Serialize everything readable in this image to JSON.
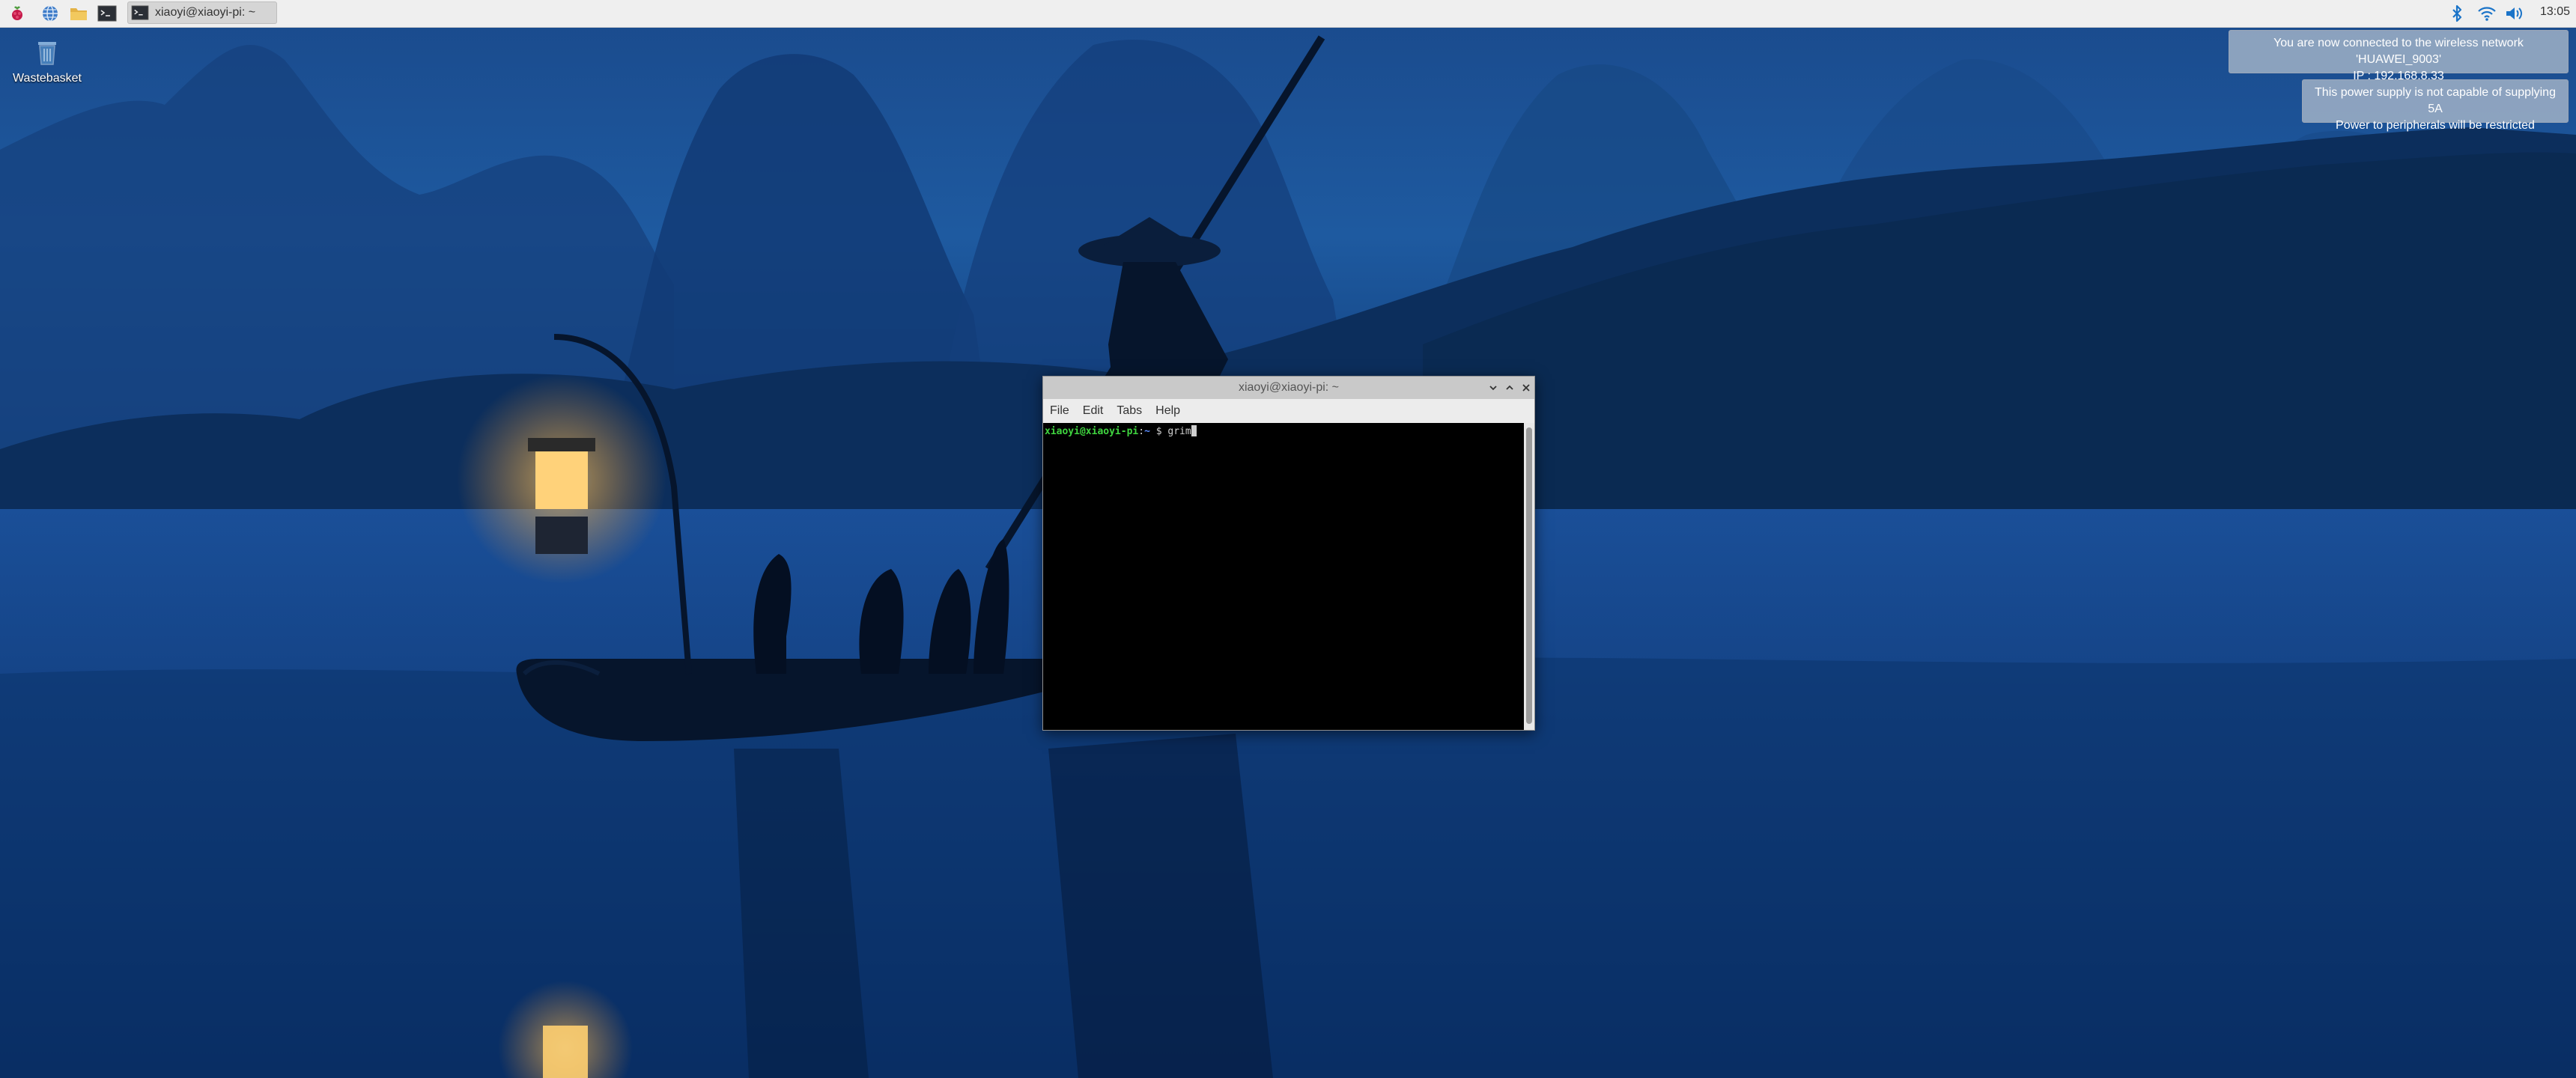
{
  "taskbar": {
    "launchers": [
      "raspberry-menu-icon",
      "web-browser-icon",
      "file-manager-icon",
      "terminal-icon"
    ],
    "window_button_label": "xiaoyi@xiaoyi-pi: ~",
    "tray": [
      "bluetooth-icon",
      "wifi-icon",
      "volume-icon"
    ],
    "clock": "13:05"
  },
  "desktop": {
    "wastebasket_label": "Wastebasket"
  },
  "notifications": {
    "wifi": {
      "line1": "You are now connected to the wireless network 'HUAWEI_9003'",
      "line2": "IP : 192.168.8.33"
    },
    "power": {
      "line1": "This power supply is not capable of supplying 5A",
      "line2": "Power to peripherals will be restricted"
    }
  },
  "terminal": {
    "title": "xiaoyi@xiaoyi-pi: ~",
    "menu": [
      "File",
      "Edit",
      "Tabs",
      "Help"
    ],
    "prompt_user": "xiaoyi@xiaoyi-pi",
    "prompt_sep": ":",
    "prompt_path": "~",
    "prompt_symbol": " $ ",
    "command": "grim"
  },
  "colors": {
    "taskbar_bg": "#efefef",
    "prompt_user": "#3fd43f",
    "prompt_path": "#5b8cff",
    "notification_bg": "#a5b4c8"
  }
}
